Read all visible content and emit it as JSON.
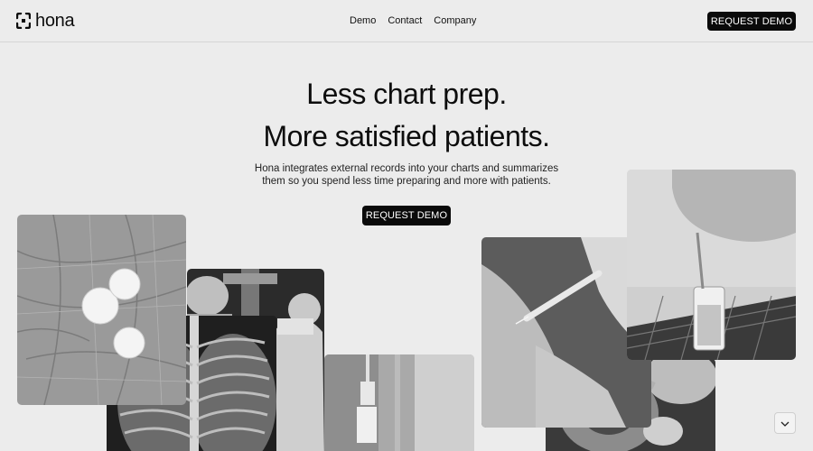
{
  "header": {
    "logo_text": "hona",
    "nav": [
      "Demo",
      "Contact",
      "Company"
    ],
    "cta_label": "REQUEST DEMO"
  },
  "hero": {
    "title_line1": "Less chart prep.",
    "title_line2": "More satisfied patients.",
    "subtitle_line1": "Hona integrates external records into your charts and summarizes",
    "subtitle_line2": "them so you spend less time preparing and more with patients.",
    "cta_label": "REQUEST DEMO"
  },
  "images": [
    {
      "name": "pills-in-hand-image"
    },
    {
      "name": "surgeons-image"
    },
    {
      "name": "chest-xray-image"
    },
    {
      "name": "iv-drip-image"
    },
    {
      "name": "syringe-image"
    },
    {
      "name": "pelvis-xray-image"
    },
    {
      "name": "test-tube-image"
    }
  ],
  "icons": {
    "logo": "hona-logo-icon",
    "scroll": "chevron-down-icon"
  }
}
